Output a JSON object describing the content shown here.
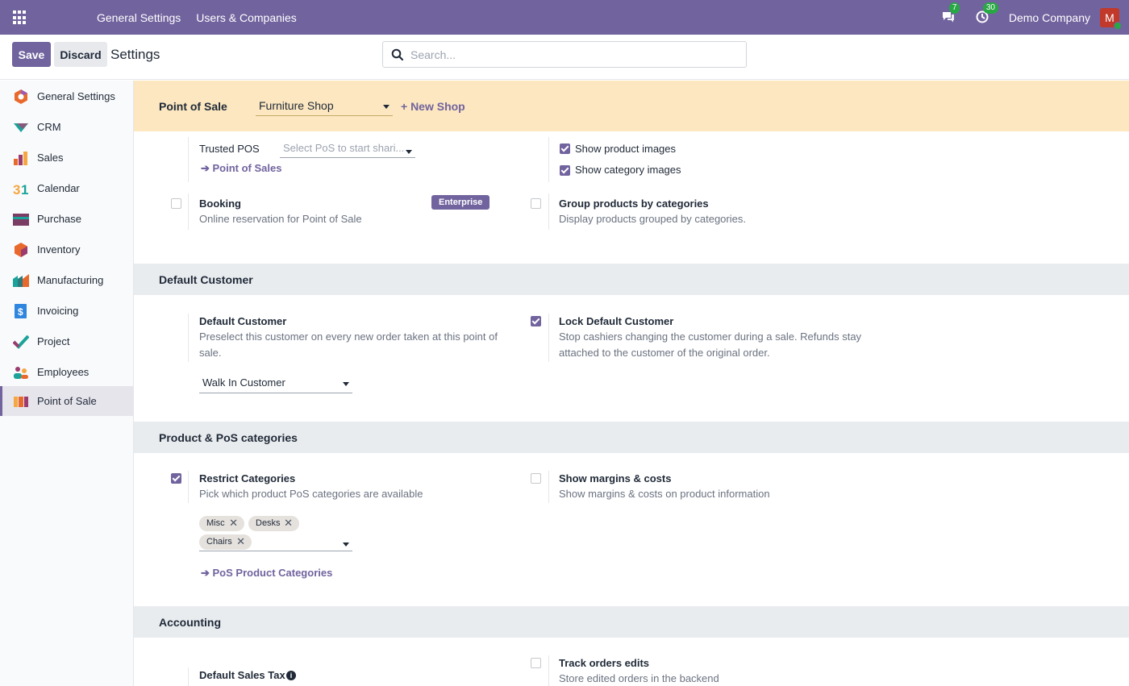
{
  "navbar": {
    "menus": [
      "General Settings",
      "Users & Companies"
    ],
    "messages_count": "7",
    "activities_count": "30",
    "company": "Demo Company",
    "avatar_letter": "M"
  },
  "control": {
    "save_label": "Save",
    "discard_label": "Discard",
    "title": "Settings",
    "search_placeholder": "Search..."
  },
  "sidebar": {
    "items": [
      {
        "label": "General Settings",
        "icon": "general-settings-icon"
      },
      {
        "label": "CRM",
        "icon": "crm-icon"
      },
      {
        "label": "Sales",
        "icon": "sales-icon"
      },
      {
        "label": "Calendar",
        "icon": "calendar-icon"
      },
      {
        "label": "Purchase",
        "icon": "purchase-icon"
      },
      {
        "label": "Inventory",
        "icon": "inventory-icon"
      },
      {
        "label": "Manufacturing",
        "icon": "manufacturing-icon"
      },
      {
        "label": "Invoicing",
        "icon": "invoicing-icon"
      },
      {
        "label": "Project",
        "icon": "project-icon"
      },
      {
        "label": "Employees",
        "icon": "employees-icon"
      },
      {
        "label": "Point of Sale",
        "icon": "point-of-sale-icon",
        "active": true
      }
    ]
  },
  "pos_bar": {
    "label": "Point of Sale",
    "shop": "Furniture Shop",
    "new_shop": "+ New Shop"
  },
  "top_section": {
    "trusted_pos_label": "Trusted POS",
    "trusted_pos_placeholder": "Select PoS to start shari...",
    "point_of_sales_link": "Point of Sales",
    "show_product_images": "Show product images",
    "show_category_images": "Show category images",
    "booking_title": "Booking",
    "booking_desc": "Online reservation for Point of Sale",
    "enterprise_badge": "Enterprise",
    "group_title": "Group products by categories",
    "group_desc": "Display products grouped by categories."
  },
  "default_customer": {
    "header": "Default Customer",
    "title": "Default Customer",
    "desc": "Preselect this customer on every new order taken at this point of sale.",
    "value": "Walk In Customer",
    "lock_title": "Lock Default Customer",
    "lock_desc": "Stop cashiers changing the customer during a sale. Refunds stay attached to the customer of the original order."
  },
  "categories": {
    "header": "Product & PoS categories",
    "restrict_title": "Restrict Categories",
    "restrict_desc": "Pick which product PoS categories are available",
    "tags": [
      "Misc",
      "Desks",
      "Chairs"
    ],
    "link": "PoS Product Categories",
    "margins_title": "Show margins & costs",
    "margins_desc": "Show margins & costs on product information"
  },
  "accounting": {
    "header": "Accounting",
    "tax_title": "Default Sales Tax",
    "track_title": "Track orders edits",
    "track_desc": "Store edited orders in the backend"
  },
  "colors": {
    "brand": "#71639e",
    "banner": "#fce7c0",
    "badge_green": "#28a745"
  }
}
